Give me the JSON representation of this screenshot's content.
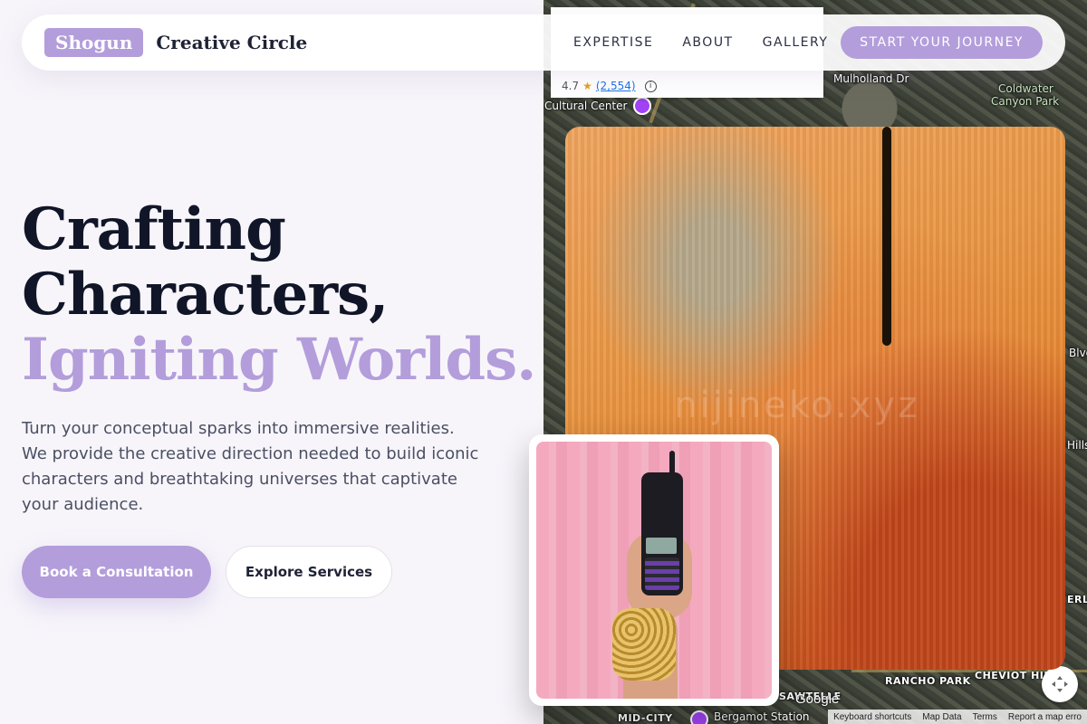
{
  "header": {
    "logo_badge": "Shogun",
    "logo_text": "Creative Circle",
    "nav": [
      "EXPERTISE",
      "ABOUT",
      "GALLERY"
    ],
    "cta_label": "START YOUR JOURNEY"
  },
  "hero": {
    "title_line1": "Crafting",
    "title_line2": "Characters,",
    "title_accent": "Igniting Worlds.",
    "description": "Turn your conceptual sparks into immersive realities. We provide the creative direction needed to build iconic characters and breathtaking universes that captivate your audience.",
    "primary_button": "Book a Consultation",
    "secondary_button": "Explore Services"
  },
  "map": {
    "rating": "4.7",
    "review_count": "(2,554)",
    "labels": {
      "mulholland": "Mulholland Dr",
      "coldwater": "Coldwater",
      "canyon_park": "Canyon Park",
      "cultural_center": "Cultural Center",
      "rancho_park": "RANCHO PARK",
      "cheviot_hills": "CHEVIOT HILL",
      "sawtelle": "SAWTELLE",
      "mid_city": "MID-CITY",
      "bergamot": "Bergamot Station",
      "hills": "Hills",
      "blvd": "Blvd",
      "erl": "ERL"
    },
    "google": "Google",
    "footer": [
      "Keyboard shortcuts",
      "Map Data",
      "Terms",
      "Report a map erro"
    ]
  },
  "watermark": "nijineko.xyz",
  "colors": {
    "accent": "#b39ddb",
    "dark_text": "#111528",
    "body_text": "#4a4f63",
    "background": "#f7f5fa"
  }
}
